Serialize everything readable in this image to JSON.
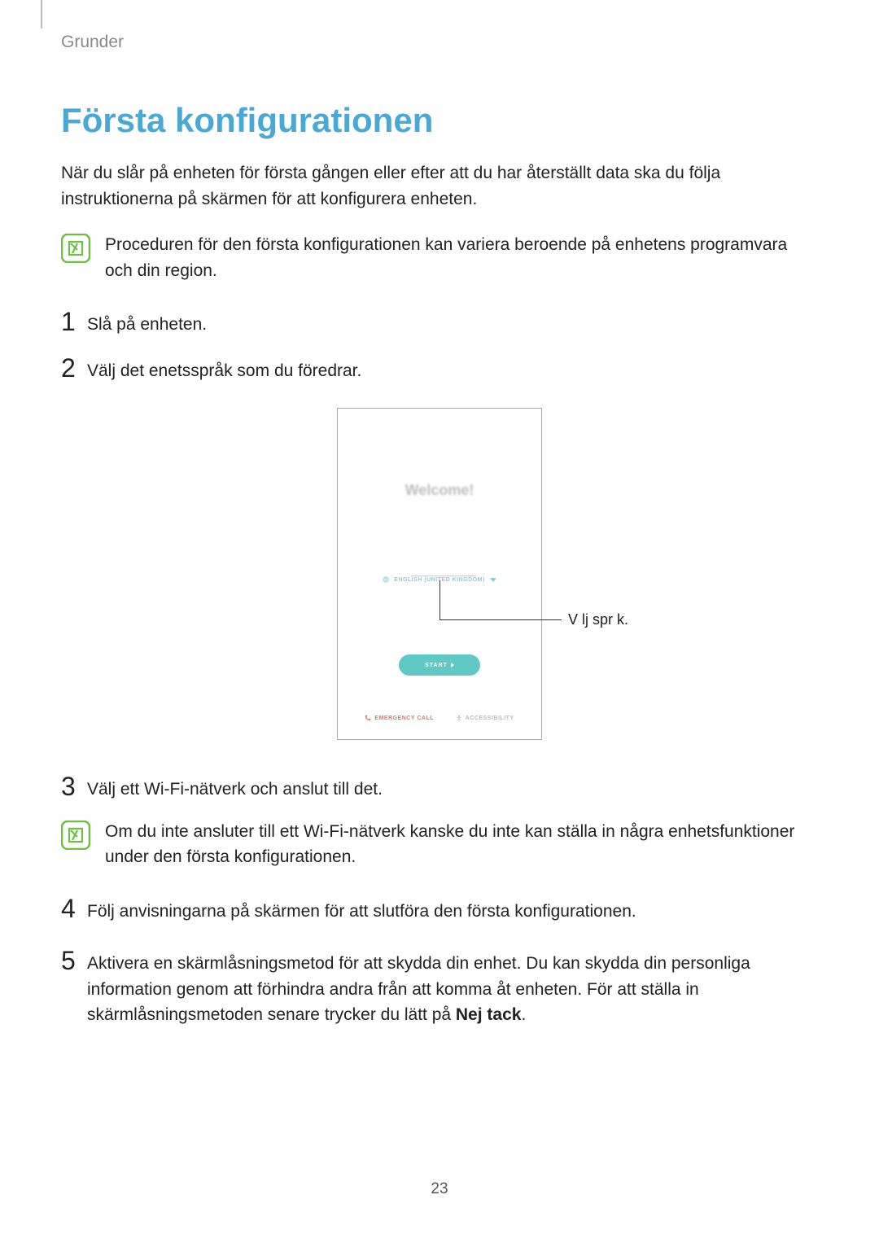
{
  "header": {
    "breadcrumb": "Grunder"
  },
  "title": "Första konfigurationen",
  "intro": "När du slår på enheten för första gången eller efter att du har återställt data ska du följa instruktionerna på skärmen för att konfigurera enheten.",
  "note1": "Proceduren för den första konfigurationen kan variera beroende på enhetens programvara och din region.",
  "steps": {
    "s1": {
      "num": "1",
      "text": "Slå på enheten."
    },
    "s2": {
      "num": "2",
      "text": "Välj det enetsspråk som du föredrar."
    },
    "s3": {
      "num": "3",
      "text": "Välj ett Wi-Fi-nätverk och anslut till det."
    },
    "s4": {
      "num": "4",
      "text": "Följ anvisningarna på skärmen för att slutföra den första konfigurationen."
    },
    "s5": {
      "num": "5",
      "text_a": "Aktivera en skärmlåsningsmetod för att skydda din enhet. Du kan skydda din personliga information genom att förhindra andra från att komma åt enheten. För att ställa in skärmlåsningsmetoden senare trycker du lätt på ",
      "bold": "Nej tack",
      "text_b": "."
    }
  },
  "note2": "Om du inte ansluter till ett Wi-Fi-nätverk kanske du inte kan ställa in några enhetsfunktioner under den första konfigurationen.",
  "phone": {
    "welcome": "Welcome!",
    "lang": "ENGLISH (UNITED KINGDOM)",
    "start": "START",
    "emergency": "EMERGENCY CALL",
    "accessibility": "ACCESSIBILITY"
  },
  "callout": "V lj spr k.",
  "page_number": "23"
}
